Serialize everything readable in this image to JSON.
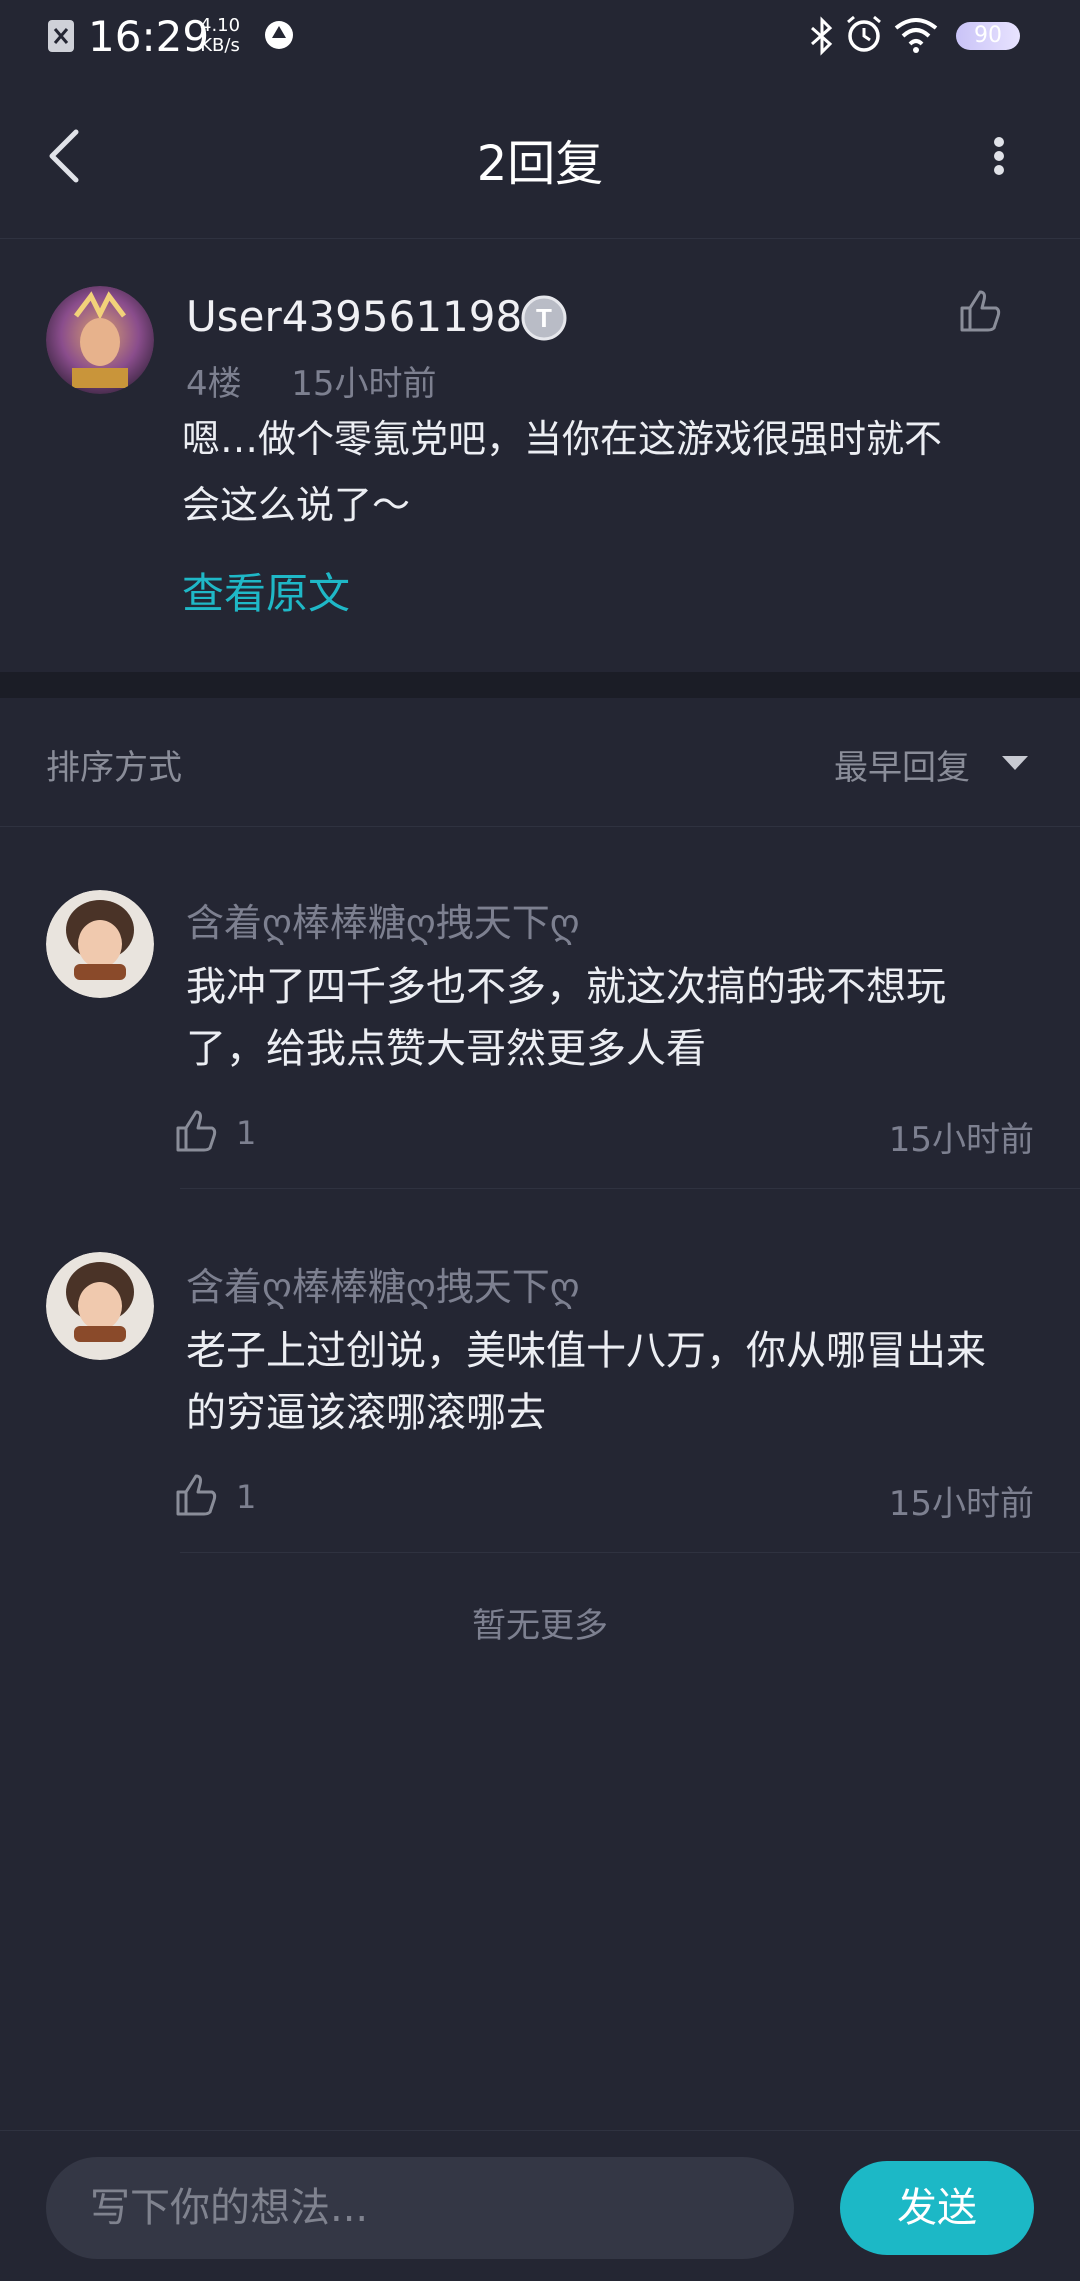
{
  "status_bar": {
    "time": "16:29",
    "speed_value": "4.10",
    "speed_unit": "KB/s",
    "battery": "90"
  },
  "header": {
    "title": "2回复"
  },
  "post": {
    "username": "User439561198",
    "floor": "4楼",
    "time": "15小时前",
    "text_line1": "嗯…做个零氪党吧，当你在这游戏很强时就不",
    "text_line2": "会这么说了～",
    "view_original": "查看原文"
  },
  "sort": {
    "label": "排序方式",
    "value": "最早回复"
  },
  "replies": [
    {
      "name": "含着ღ棒棒糖ღ拽天下ღ",
      "line1": "我冲了四千多也不多，就这次搞的我不想玩",
      "line2": "了，给我点赞大哥然更多人看",
      "likes": "1",
      "time": "15小时前"
    },
    {
      "name": "含着ღ棒棒糖ღ拽天下ღ",
      "line1": "老子上过创说，美味值十八万，你从哪冒出来",
      "line2": "的穷逼该滚哪滚哪去",
      "likes": "1",
      "time": "15小时前"
    }
  ],
  "no_more": "暂无更多",
  "composer": {
    "placeholder": "写下你的想法...",
    "send_label": "发送"
  },
  "colors": {
    "accent": "#1cb8c6",
    "background": "#242633"
  }
}
